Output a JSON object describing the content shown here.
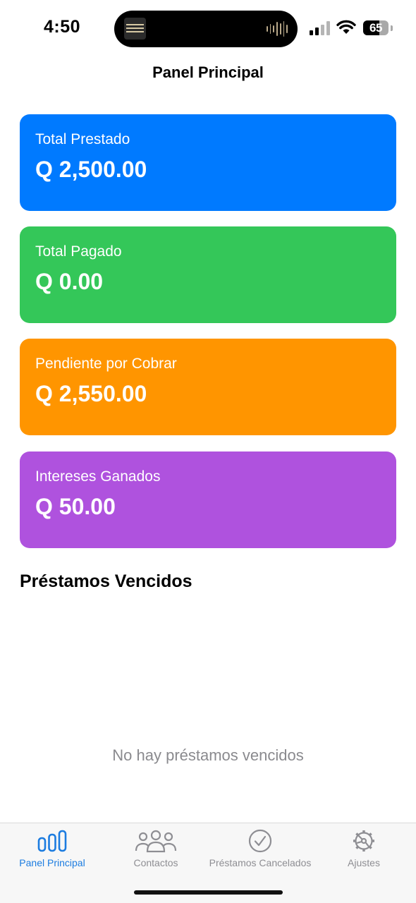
{
  "status_bar": {
    "time": "4:50",
    "battery": "65",
    "battery_level": 0.65
  },
  "nav": {
    "title": "Panel Principal"
  },
  "cards": [
    {
      "label": "Total Prestado",
      "value": "Q 2,500.00",
      "color": "#007AFF"
    },
    {
      "label": "Total Pagado",
      "value": "Q 0.00",
      "color": "#34C759"
    },
    {
      "label": "Pendiente por Cobrar",
      "value": "Q 2,550.00",
      "color": "#FF9500"
    },
    {
      "label": "Intereses Ganados",
      "value": "Q 50.00",
      "color": "#AF52DE"
    }
  ],
  "overdue": {
    "title": "Préstamos Vencidos",
    "empty_message": "No hay préstamos vencidos"
  },
  "tabs": [
    {
      "label": "Panel Principal",
      "icon": "chart-bars-icon",
      "active": true
    },
    {
      "label": "Contactos",
      "icon": "people-icon",
      "active": false
    },
    {
      "label": "Préstamos Cancelados",
      "icon": "checkmark-circle-icon",
      "active": false
    },
    {
      "label": "Ajustes",
      "icon": "gear-icon",
      "active": false
    }
  ],
  "colors": {
    "tab_active": "#1C7CE0",
    "tab_inactive": "#8E8E93",
    "empty_text": "#8A8A8E"
  }
}
